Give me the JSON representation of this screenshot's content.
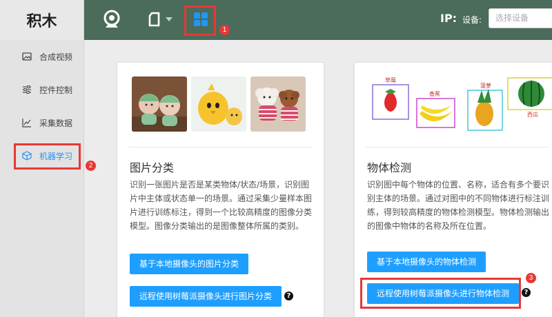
{
  "app": {
    "logo": "积木"
  },
  "sidebar": {
    "items": [
      {
        "label": "合成视频",
        "icon": "image-icon"
      },
      {
        "label": "控件控制",
        "icon": "sliders-icon"
      },
      {
        "label": "采集数据",
        "icon": "chart-icon"
      },
      {
        "label": "机器学习",
        "icon": "cube-icon",
        "active": true
      }
    ]
  },
  "header": {
    "ip_label": "IP:",
    "device_label": "设备:",
    "device_placeholder": "选择设备"
  },
  "cards": [
    {
      "title": "图片分类",
      "description": "识别一张图片是否是某类物体/状态/场景，识别图片中主体或状态单一的场景。通过采集少量样本图片进行训练标注，得到一个比较高精度的图像分类模型。图像分类输出的是图像整体所属的类别。",
      "button_local": "基于本地摄像头的图片分类",
      "button_remote": "远程使用树莓派摄像头进行图片分类",
      "images": [
        "toy-figures-image",
        "yellow-chick-image",
        "puppies-image"
      ]
    },
    {
      "title": "物体检测",
      "description": "识别图中每个物体的位置、名称，适合有多个要识别主体的场景。通过对图中的不同物体进行标注训练，得到较高精度的物体检测模型。物体检测输出的图像中物体的名称及所在位置。",
      "button_local": "基于本地摄像头的物体检测",
      "button_remote": "远程使用树莓派摄像头进行物体检测",
      "fruit_labels": [
        "草莓",
        "香蕉",
        "菠萝",
        "西瓜"
      ]
    }
  ],
  "annotations": [
    "1",
    "2",
    "3"
  ],
  "colors": {
    "header": "#4b6b5b",
    "accent": "#1e9fff",
    "highlight": "#e53935"
  }
}
